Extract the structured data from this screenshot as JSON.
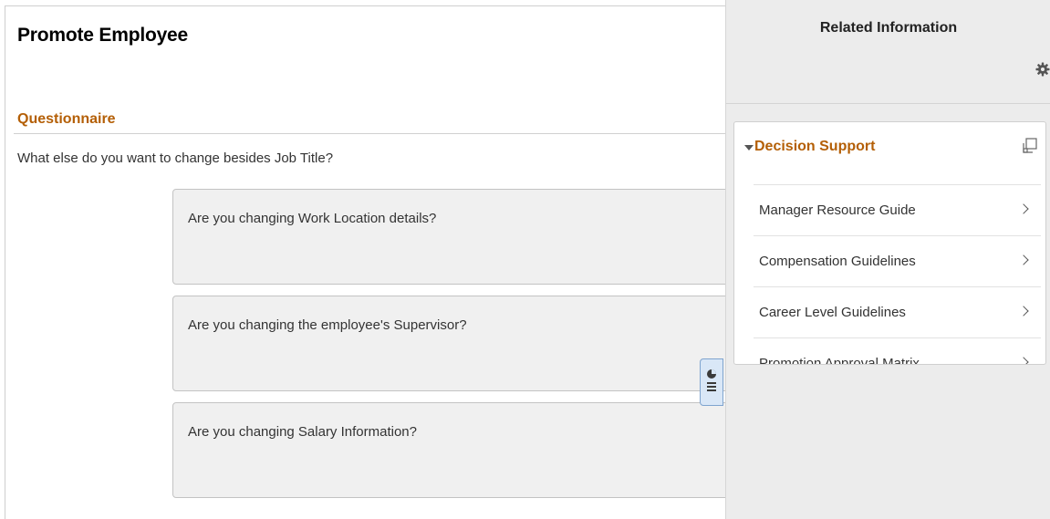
{
  "page": {
    "title": "Promote Employee"
  },
  "questionnaire": {
    "section_title": "Questionnaire",
    "prompt": "What else do you want to change besides Job Title?",
    "questions": [
      {
        "label": "Are you changing Work Location details?"
      },
      {
        "label": "Are you changing the employee's Supervisor?"
      },
      {
        "label": "Are you changing Salary Information?"
      }
    ]
  },
  "related_panel": {
    "title": "Related Information",
    "settings_icon": "gear-icon",
    "decision_support": {
      "title": "Decision Support",
      "expanded": true,
      "items": [
        {
          "label": "Manager Resource Guide"
        },
        {
          "label": "Compensation Guidelines"
        },
        {
          "label": "Career Level Guidelines"
        },
        {
          "label": "Promotion Approval Matrix"
        }
      ]
    }
  },
  "colors": {
    "accent": "#b45f06",
    "panel_bg": "#ececec",
    "card_bg": "#f0f0f0",
    "toggle_bg": "#d9e7f7"
  }
}
